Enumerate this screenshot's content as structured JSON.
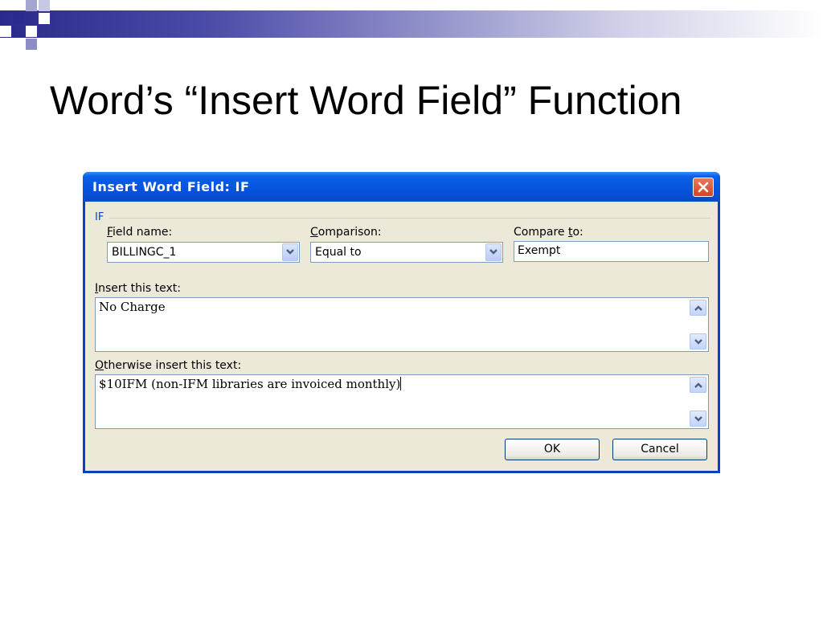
{
  "slide": {
    "title": "Word’s “Insert Word Field” Function"
  },
  "dialog": {
    "title": "Insert Word Field: IF",
    "group_label": "IF",
    "field_name": {
      "label_accel": "F",
      "label_rest": "ield name:",
      "value": "BILLINGC_1"
    },
    "comparison": {
      "label_accel": "C",
      "label_rest": "omparison:",
      "value": "Equal to"
    },
    "compare_to": {
      "label_before": "Compare ",
      "label_accel": "t",
      "label_rest": "o:",
      "value": "Exempt"
    },
    "insert_text": {
      "label_accel": "I",
      "label_rest": "nsert this text:",
      "value": "No Charge"
    },
    "otherwise_text": {
      "label_accel": "O",
      "label_rest": "therwise insert this text:",
      "value": "$10IFM (non-IFM libraries are invoiced monthly)"
    },
    "ok_label": "OK",
    "cancel_label": "Cancel"
  },
  "colors": {
    "titlebar": "#0553dc",
    "dialog_bg": "#ece9d8",
    "group_label": "#0046d5",
    "header_band_start": "#2a2a8c"
  },
  "icons": {
    "close": "close-x-icon",
    "dropdown": "chevron-down-icon",
    "scroll_up": "chevron-up-icon",
    "scroll_down": "chevron-down-icon"
  }
}
